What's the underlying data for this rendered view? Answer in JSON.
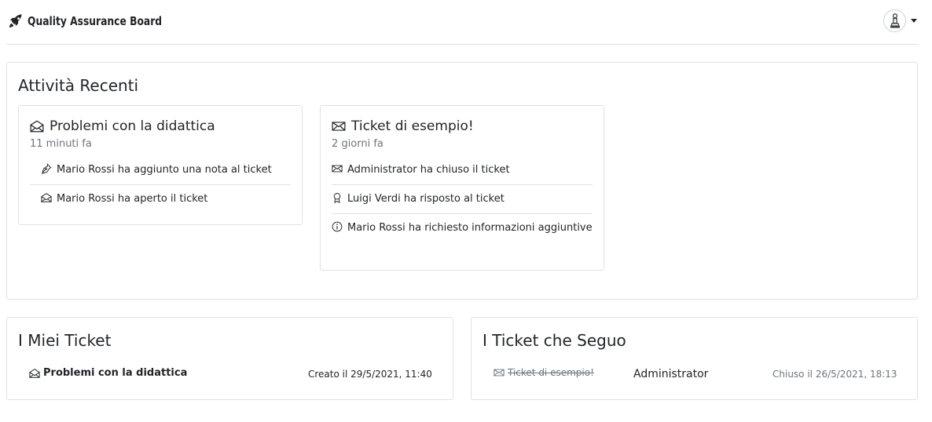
{
  "navbar": {
    "brand_icon": "rocket-icon",
    "brand": "Quality Assurance Board",
    "user_icon": "chess-pawn-icon"
  },
  "recent": {
    "title": "Attività Recenti",
    "items": [
      {
        "icon": "envelope-open-icon",
        "title": "Problemi con la didattica",
        "time": "11 minuti fa",
        "events": [
          {
            "icon": "pen-nib-icon",
            "text": "Mario Rossi ha aggiunto una nota al ticket"
          },
          {
            "icon": "envelope-open-icon",
            "text": "Mario Rossi ha aperto il ticket"
          }
        ]
      },
      {
        "icon": "envelope-icon",
        "title": "Ticket di esempio!",
        "time": "2 giorni fa",
        "events": [
          {
            "icon": "envelope-icon",
            "text": "Administrator ha chiuso il ticket"
          },
          {
            "icon": "award-icon",
            "text": "Luigi Verdi ha risposto al ticket"
          },
          {
            "icon": "info-circle-icon",
            "text": "Mario Rossi ha richiesto informazioni aggiuntive"
          }
        ]
      }
    ]
  },
  "my_tickets": {
    "title": "I Miei Ticket",
    "items": [
      {
        "icon": "envelope-open-icon",
        "title": "Problemi con la didattica",
        "date": "Creato il 29/5/2021, 11:40"
      }
    ]
  },
  "followed_tickets": {
    "title": "I Ticket che Seguo",
    "items": [
      {
        "icon": "envelope-icon",
        "title": "Ticket di esempio!",
        "author": "Administrator",
        "date": "Chiuso il 26/5/2021, 18:13"
      }
    ]
  }
}
